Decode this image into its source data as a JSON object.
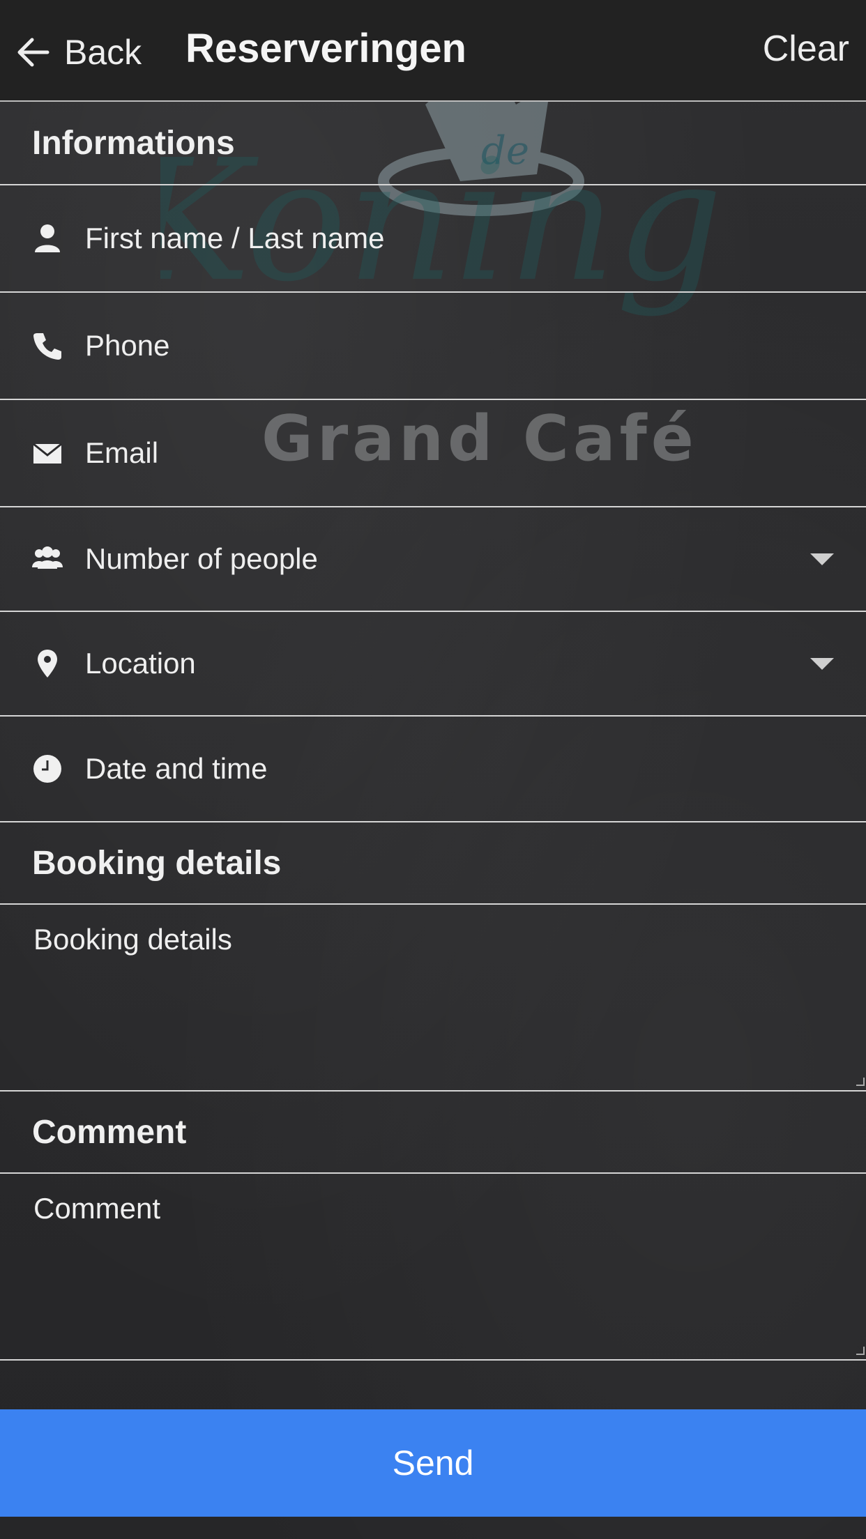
{
  "header": {
    "back_label": "Back",
    "title": "Reserveringen",
    "clear_label": "Clear"
  },
  "watermark": {
    "brand_word": "Koning",
    "crown_text": "de",
    "tagline": "Grand Café"
  },
  "sections": {
    "informations": "Informations",
    "booking_details": "Booking details",
    "comment": "Comment"
  },
  "fields": {
    "name": {
      "placeholder": "First name / Last name",
      "icon": "person-icon"
    },
    "phone": {
      "placeholder": "Phone",
      "icon": "phone-icon"
    },
    "email": {
      "placeholder": "Email",
      "icon": "envelope-icon"
    },
    "people": {
      "placeholder": "Number of people",
      "icon": "group-icon"
    },
    "location": {
      "placeholder": "Location",
      "icon": "map-pin-icon"
    },
    "datetime": {
      "placeholder": "Date and time",
      "icon": "clock-icon"
    },
    "booking_details": {
      "placeholder": "Booking details"
    },
    "comment": {
      "placeholder": "Comment"
    }
  },
  "actions": {
    "send_label": "Send"
  },
  "colors": {
    "accent": "#3b82f1",
    "topbar": "#222222",
    "divider": "#d6d6d6"
  }
}
